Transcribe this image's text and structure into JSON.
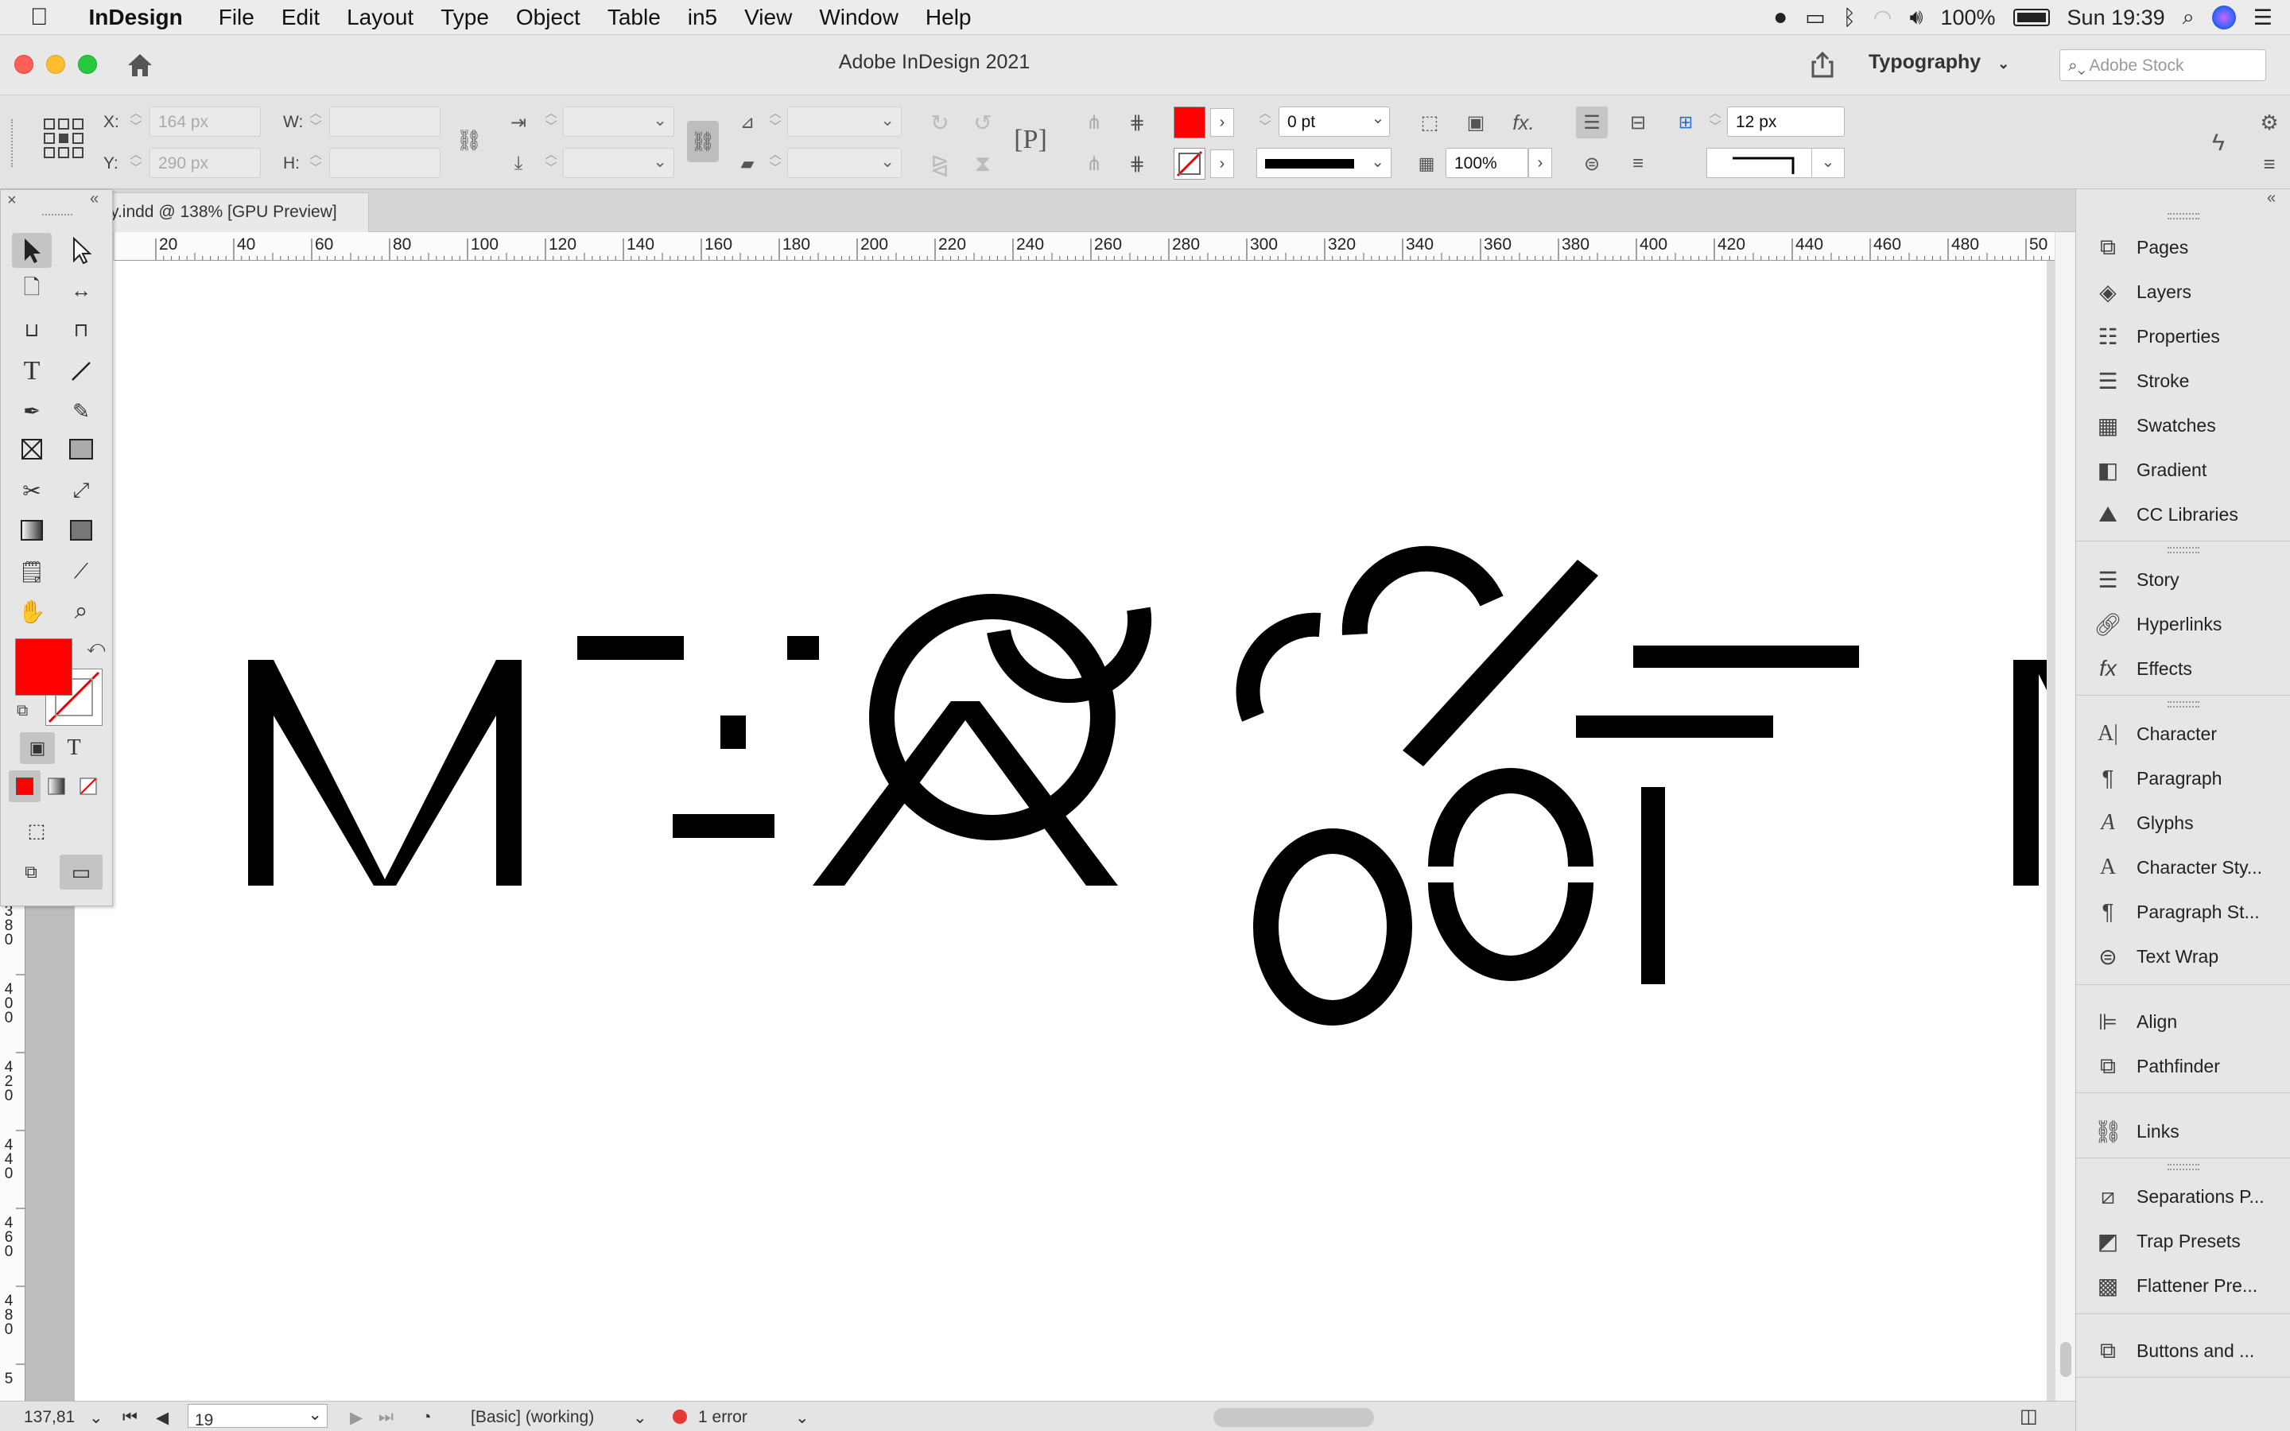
{
  "menubar": {
    "apple": "",
    "app": "InDesign",
    "items": [
      "File",
      "Edit",
      "Layout",
      "Type",
      "Object",
      "Table",
      "in5",
      "View",
      "Window",
      "Help"
    ],
    "battery": "100%",
    "clock": "Sun 19:39"
  },
  "titlebar": {
    "title": "Adobe InDesign 2021",
    "workspace": "Typography",
    "search_placeholder": "Adobe Stock"
  },
  "control": {
    "x_label": "X:",
    "x_value": "164 px",
    "y_label": "Y:",
    "y_value": "290 px",
    "w_label": "W:",
    "h_label": "H:",
    "stroke_weight": "0 pt",
    "opacity": "100%",
    "spacing": "12 px",
    "fill_color": "#ff0000"
  },
  "document": {
    "tab_title": "y.indd @ 138% [GPU Preview]",
    "ruler_h": [
      "20",
      "40",
      "60",
      "80",
      "100",
      "120",
      "140",
      "160",
      "180",
      "200",
      "220",
      "240",
      "260",
      "280",
      "300",
      "320",
      "340",
      "360",
      "380",
      "400",
      "420",
      "440",
      "460",
      "480",
      "50"
    ],
    "ruler_v": [
      "380",
      "400",
      "420",
      "440",
      "460",
      "480",
      "5"
    ]
  },
  "toolbox": {
    "fill_color": "#ff0000",
    "type_glyph": "T"
  },
  "panels": {
    "group1": [
      "Pages",
      "Layers",
      "Properties",
      "Stroke",
      "Swatches",
      "Gradient",
      "CC Libraries"
    ],
    "group2": [
      "Story",
      "Hyperlinks",
      "Effects"
    ],
    "group3": [
      "Character",
      "Paragraph",
      "Glyphs",
      "Character Sty...",
      "Paragraph St...",
      "Text Wrap"
    ],
    "group4": [
      "Align",
      "Pathfinder"
    ],
    "group5": [
      "Links"
    ],
    "group6": [
      "Separations P...",
      "Trap Presets",
      "Flattener Pre..."
    ],
    "group7": [
      "Buttons and ..."
    ]
  },
  "status": {
    "zoom": "137,81",
    "page": "19",
    "preflight_profile": "[Basic] (working)",
    "errors": "1 error",
    "error_color": "#e53935"
  }
}
